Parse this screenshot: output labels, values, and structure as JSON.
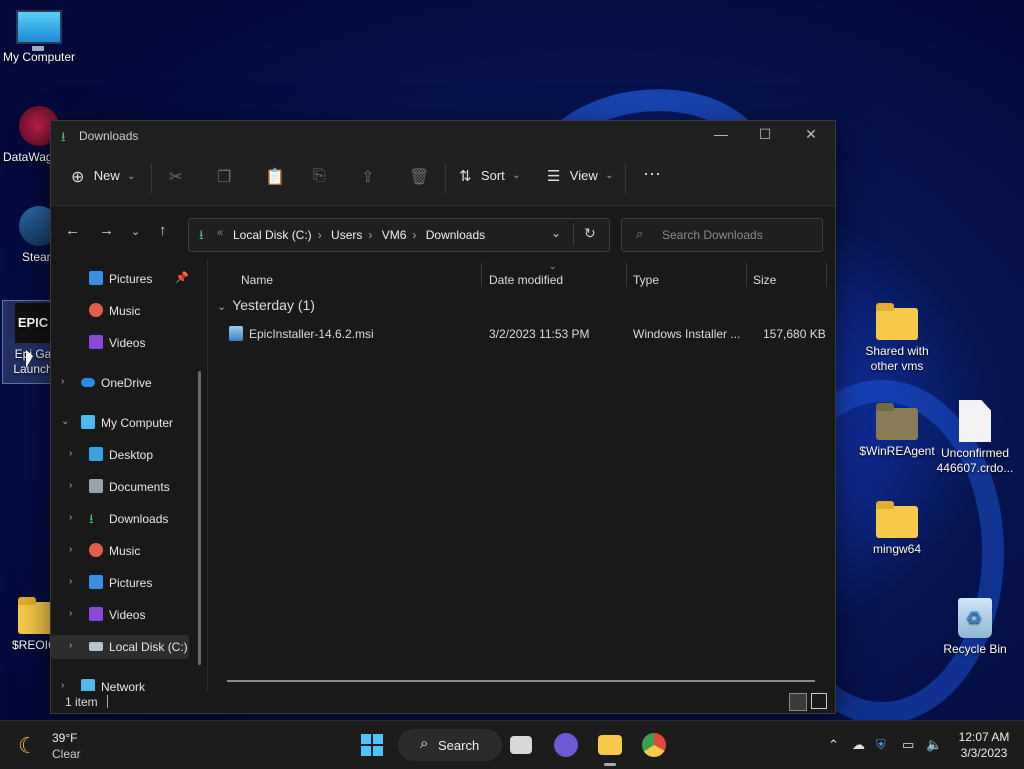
{
  "desktop": {
    "icons": [
      {
        "label": "My Computer",
        "icon": "computer-icon"
      },
      {
        "label": "DataWag",
        "icon": "datawag-icon"
      },
      {
        "label": "Steam",
        "icon": "steam-icon"
      },
      {
        "label": "Epic Games Launcher",
        "line1": "Epi Ga",
        "line2": "Launch",
        "icon": "epic-games-icon"
      },
      {
        "label": "$REOIC",
        "icon": "folder-icon"
      },
      {
        "label1": "Shared with",
        "label2": "other vms",
        "icon": "folder-icon"
      },
      {
        "label": "$WinREAgent",
        "icon": "folder-icon"
      },
      {
        "label1": "Unconfirmed",
        "label2": "446607.crdo...",
        "icon": "file-icon"
      },
      {
        "label": "mingw64",
        "icon": "folder-icon"
      },
      {
        "label": "Recycle Bin",
        "icon": "recycle-bin-icon"
      }
    ]
  },
  "window": {
    "title": "Downloads",
    "toolbar": {
      "new_label": "New",
      "sort_label": "Sort",
      "view_label": "View"
    },
    "address": {
      "crumbs": [
        "Local Disk (C:)",
        "Users",
        "VM6",
        "Downloads"
      ]
    },
    "search_placeholder": "Search Downloads",
    "nav_items": [
      {
        "label": "Pictures",
        "pinned": true
      },
      {
        "label": "Music"
      },
      {
        "label": "Videos"
      },
      {
        "label": "OneDrive"
      },
      {
        "label": "My Computer"
      },
      {
        "label": "Desktop"
      },
      {
        "label": "Documents"
      },
      {
        "label": "Downloads"
      },
      {
        "label": "Music"
      },
      {
        "label": "Pictures"
      },
      {
        "label": "Videos"
      },
      {
        "label": "Local Disk (C:)"
      },
      {
        "label": "Network"
      }
    ],
    "columns": [
      "Name",
      "Date modified",
      "Type",
      "Size"
    ],
    "group_label": "Yesterday (1)",
    "files": [
      {
        "name": "EpicInstaller-14.6.2.msi",
        "date": "3/2/2023 11:53 PM",
        "type": "Windows Installer ...",
        "size": "157,680 KB"
      }
    ],
    "status": "1 item"
  },
  "taskbar": {
    "weather_temp": "39°F",
    "weather_desc": "Clear",
    "search_label": "Search",
    "time": "12:07 AM",
    "date": "3/3/2023"
  },
  "colors": {
    "accent": "#0067c0",
    "folder": "#f6c94a",
    "download_green": "#4cc26b"
  }
}
